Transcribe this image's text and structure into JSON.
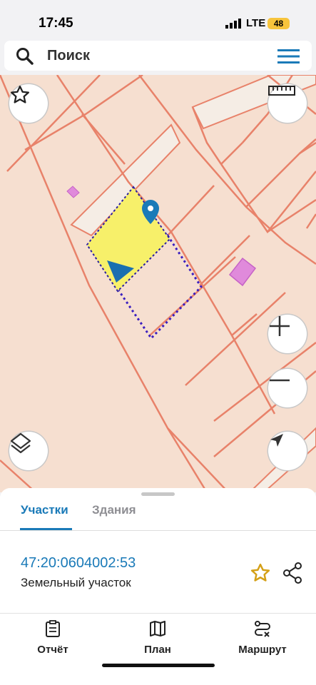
{
  "status": {
    "time": "17:45",
    "network": "LTE",
    "battery": "48"
  },
  "search": {
    "placeholder": "Поиск"
  },
  "map": {
    "buttons": [
      "star-icon",
      "ruler-icon",
      "layers-icon",
      "zoom-in-icon",
      "zoom-out-icon",
      "location-arrow-icon"
    ]
  },
  "panel": {
    "tabs": [
      {
        "label": "Участки",
        "active": true
      },
      {
        "label": "Здания",
        "active": false
      }
    ],
    "parcel": {
      "cadastral_number": "47:20:0604002:53",
      "type": "Земельный участок"
    }
  },
  "tabbar": [
    {
      "label": "Отчёт",
      "icon": "clipboard-icon"
    },
    {
      "label": "План",
      "icon": "map-icon"
    },
    {
      "label": "Маршрут",
      "icon": "route-icon"
    }
  ],
  "colors": {
    "accent": "#1a7ab8",
    "parcel_fill": "#f7f06a",
    "boundary": "#e8826a",
    "map_bg": "#f6dfd0",
    "favorite": "#d4a017"
  }
}
